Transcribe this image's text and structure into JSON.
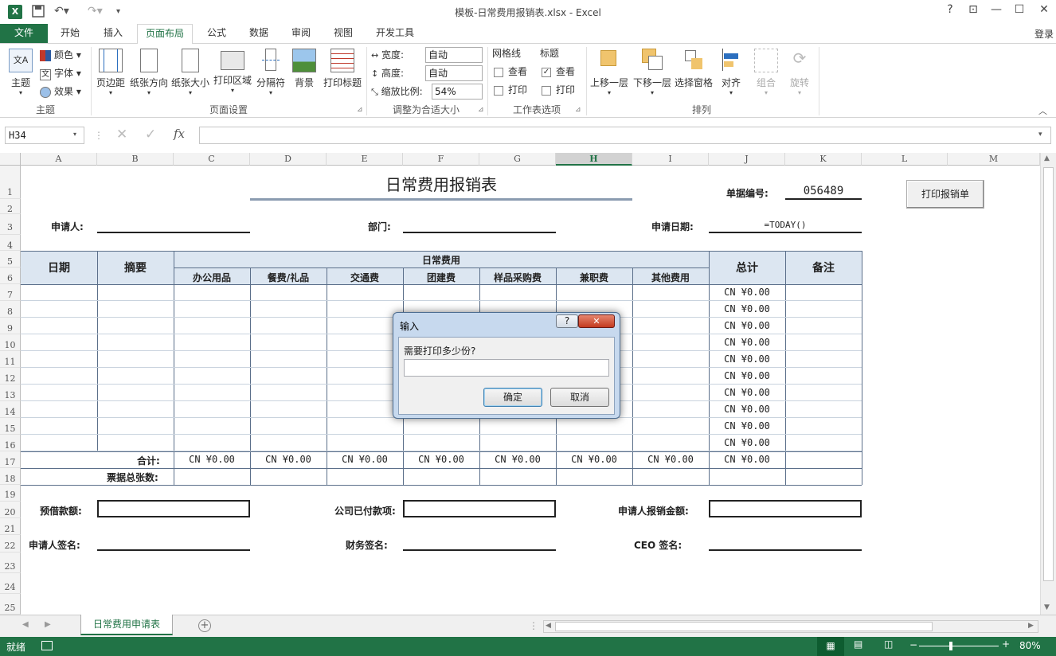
{
  "app": {
    "title": "模板-日常费用报销表.xlsx - Excel",
    "login": "登录",
    "help": "?",
    "icon": "excel-logo-icon"
  },
  "tabs": {
    "file": "文件",
    "items": [
      "开始",
      "插入",
      "页面布局",
      "公式",
      "数据",
      "审阅",
      "视图",
      "开发工具"
    ],
    "active": "页面布局"
  },
  "ribbon": {
    "theme_group": {
      "label": "主题",
      "theme_btn": "主题",
      "colors": "颜色",
      "fonts": "字体",
      "effects": "效果"
    },
    "page_setup_group": {
      "label": "页面设置",
      "buttons": [
        "页边距",
        "纸张方向",
        "纸张大小",
        "打印区域",
        "分隔符",
        "背景",
        "打印标题"
      ]
    },
    "scale_group": {
      "label": "调整为合适大小",
      "width_label": "宽度:",
      "width_value": "自动",
      "height_label": "高度:",
      "height_value": "自动",
      "scale_label": "缩放比例:",
      "scale_value": "54%"
    },
    "sheet_options_group": {
      "label": "工作表选项",
      "gridlines": "网格线",
      "headings": "标题",
      "view": "查看",
      "print": "打印"
    },
    "arrange_group": {
      "label": "排列",
      "buttons": [
        "上移一层",
        "下移一层",
        "选择窗格",
        "对齐",
        "组合",
        "旋转"
      ]
    }
  },
  "formula_bar": {
    "name_box": "H34",
    "fx": "fx",
    "formula": ""
  },
  "grid": {
    "columns": [
      "A",
      "B",
      "C",
      "D",
      "E",
      "F",
      "G",
      "H",
      "I",
      "J",
      "K",
      "L",
      "M"
    ],
    "active_column": "H",
    "rows": [
      "1",
      "2",
      "3",
      "4",
      "5",
      "6",
      "7",
      "8",
      "9",
      "10",
      "11",
      "12",
      "13",
      "14",
      "15",
      "16",
      "17",
      "18",
      "19",
      "20",
      "21",
      "22",
      "23",
      "24",
      "25"
    ]
  },
  "form": {
    "title": "日常费用报销表",
    "doc_no_label": "单据编号:",
    "doc_no": "056489",
    "print_button": "打印报销单",
    "applicant_label": "申请人:",
    "dept_label": "部门:",
    "date_label": "申请日期:",
    "date_formula": "=TODAY()",
    "header_date": "日期",
    "header_summary": "摘要",
    "header_daily": "日常费用",
    "header_total": "总计",
    "header_note": "备注",
    "sub_headers": [
      "办公用品",
      "餐费/礼品",
      "交通费",
      "团建费",
      "样品采购费",
      "兼职费",
      "其他费用"
    ],
    "currency_zero": "CN ¥0.00",
    "subtotal_label": "合计:",
    "receipt_count_label": "票据总张数:",
    "advance_label": "预借款额:",
    "company_paid_label": "公司已付款项:",
    "reimburse_total_label": "申请人报销金额:",
    "applicant_sign_label": "申请人签名:",
    "finance_sign_label": "财务签名:",
    "ceo_sign_label": "CEO 签名:"
  },
  "dialog": {
    "title": "输入",
    "help": "?",
    "prompt": "需要打印多少份?",
    "input_value": "",
    "ok": "确定",
    "cancel": "取消"
  },
  "sheet_tabs": {
    "active": "日常费用申请表",
    "add": "+"
  },
  "status": {
    "ready": "就绪",
    "zoom": "80%"
  },
  "colors": {
    "excel_green": "#217346",
    "table_border": "#5b6f8a",
    "dialog_frame": "#c7d9ee"
  }
}
